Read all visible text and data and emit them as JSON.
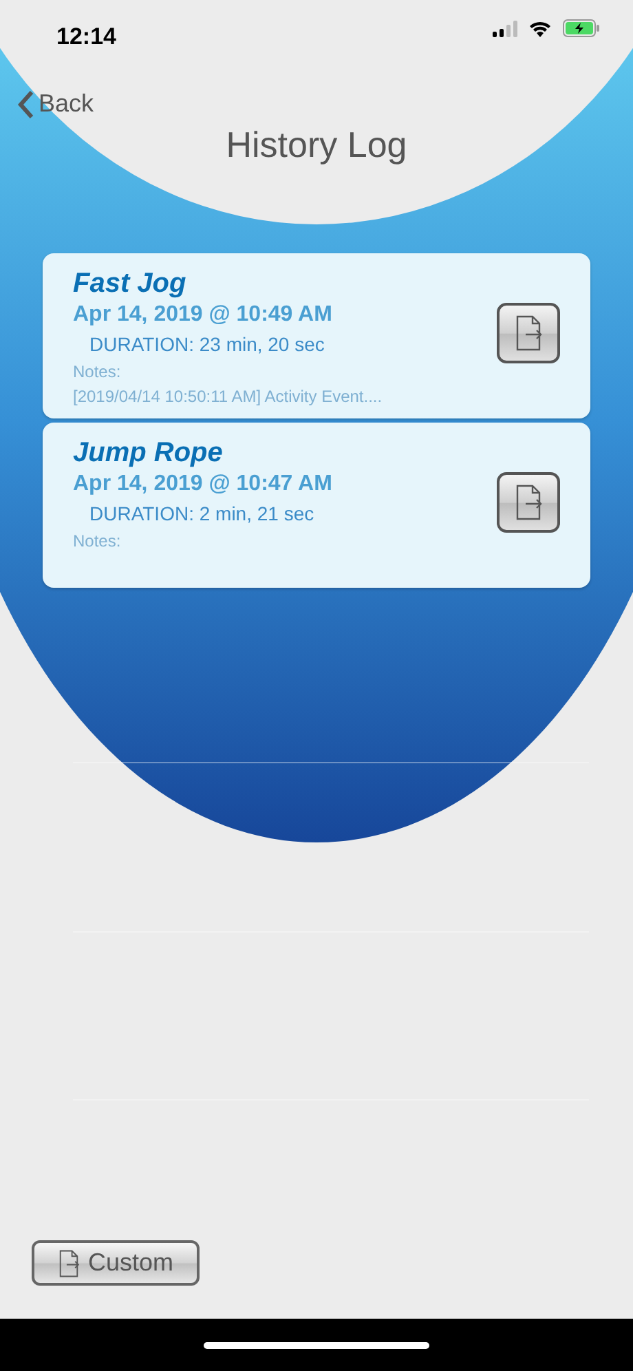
{
  "status_bar": {
    "time": "12:14"
  },
  "nav": {
    "back": "Back",
    "title": "History Log"
  },
  "entries": [
    {
      "name": "Fast Jog",
      "date": "Apr 14, 2019 @ 10:49 AM",
      "duration": "DURATION: 23 min, 20 sec",
      "notes_label": "Notes:",
      "notes": "[2019/04/14 10:50:11 AM] Activity Event...."
    },
    {
      "name": "Jump Rope",
      "date": "Apr 14, 2019 @ 10:47 AM",
      "duration": "DURATION: 2 min, 21 sec",
      "notes_label": "Notes:"
    }
  ],
  "footer": {
    "button": "Custom"
  }
}
